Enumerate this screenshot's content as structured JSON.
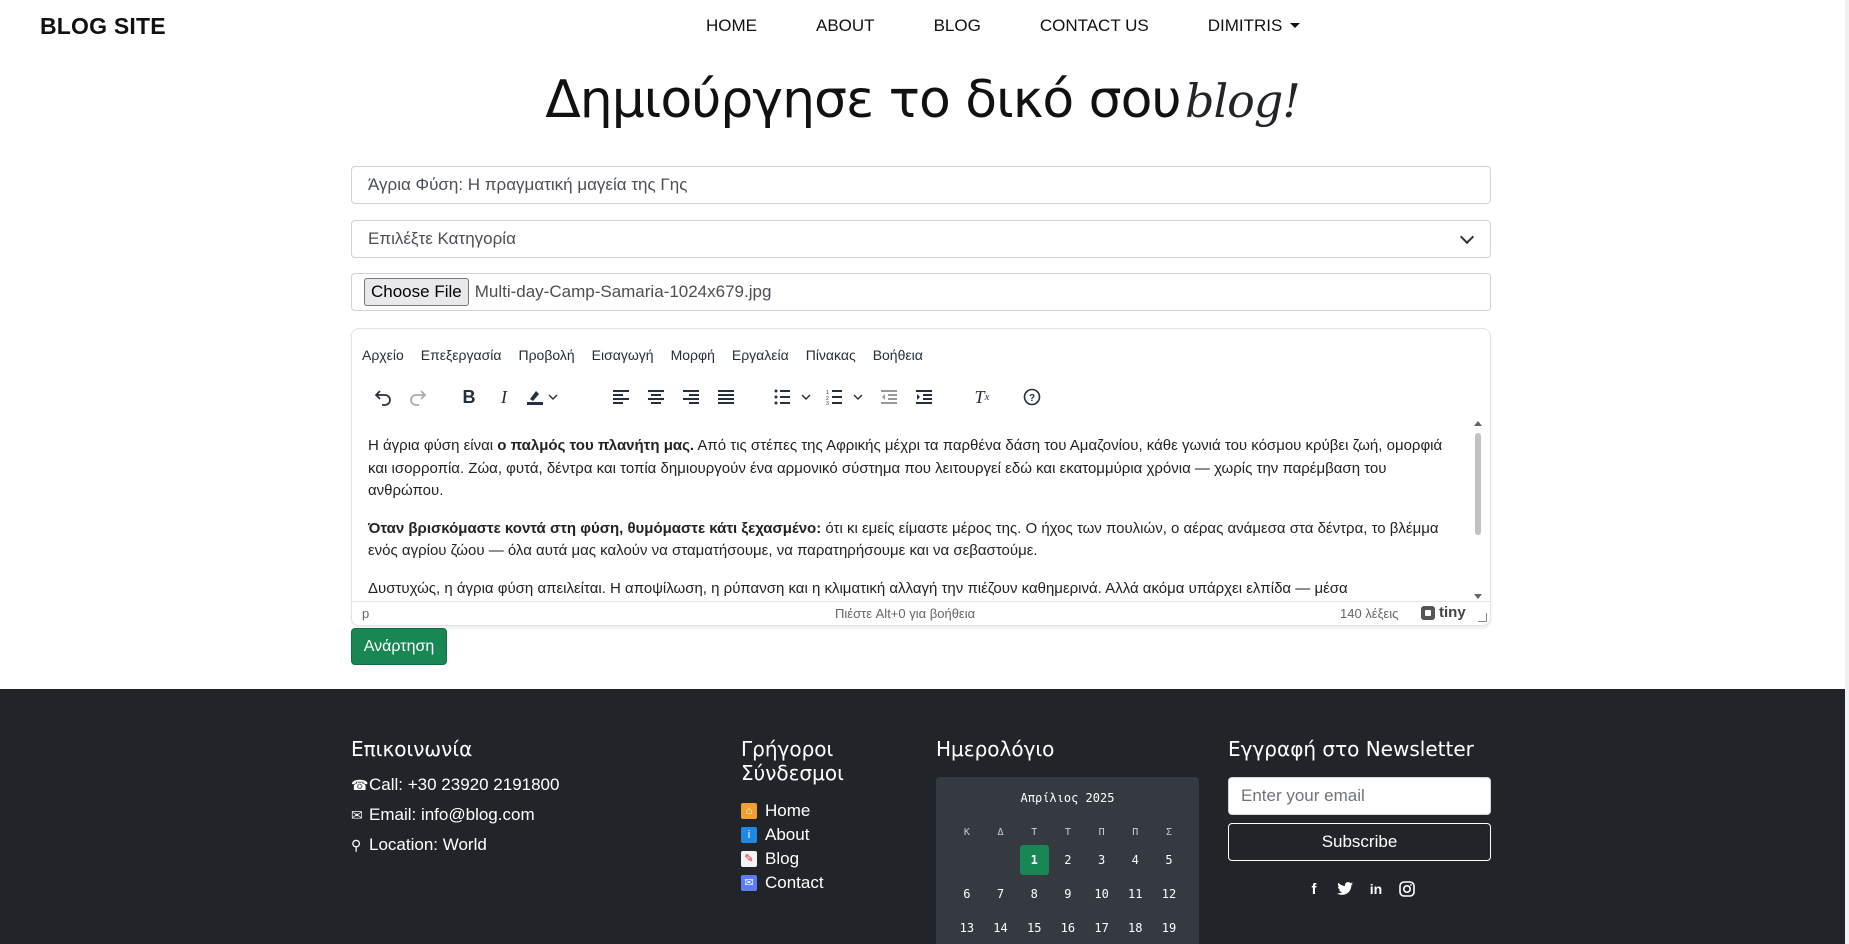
{
  "brand": "BLOG SITE",
  "nav": {
    "links": [
      "HOME",
      "ABOUT",
      "BLOG",
      "CONTACT US"
    ],
    "user": "DIMITRIS"
  },
  "hero": {
    "title": "Δημιούργησε το δικό σου",
    "accent": "blog!"
  },
  "form": {
    "title_value": "Άγρια Φύση: Η πραγματική μαγεία της Γης",
    "category_selected": "Επιλέξτε Κατηγορία",
    "file_button": "Choose File",
    "file_name": "Multi-day-Camp-Samaria-1024x679.jpg",
    "submit_label": "Ανάρτηση"
  },
  "editor": {
    "menu": [
      "Αρχείο",
      "Επεξεργασία",
      "Προβολή",
      "Εισαγωγή",
      "Μορφή",
      "Εργαλεία",
      "Πίνακας",
      "Βοήθεια"
    ],
    "p1_bold": "ο παλμός του πλανήτη μας.",
    "p1_pre": "Η άγρια φύση είναι ",
    "p1_post": " Από τις στέπες της Αφρικής μέχρι τα παρθένα δάση του Αμαζονίου, κάθε γωνιά του κόσμου κρύβει ζωή, ομορφιά και ισορροπία. Ζώα, φυτά, δέντρα και τοπία δημιουργούν ένα αρμονικό σύστημα που λειτουργεί εδώ και εκατομμύρια χρόνια — χωρίς την παρέμβαση του ανθρώπου.",
    "p2_bold": "Όταν βρισκόμαστε κοντά στη φύση, θυμόμαστε κάτι ξεχασμένο:",
    "p2_post": " ότι κι εμείς είμαστε μέρος της. Ο ήχος των πουλιών, ο αέρας ανάμεσα στα δέντρα, το βλέμμα ενός αγρίου ζώου — όλα αυτά μας καλούν να σταματήσουμε, να παρατηρήσουμε και να σεβαστούμε.",
    "p3": "Δυστυχώς, η άγρια φύση απειλείται. Η αποψίλωση, η ρύπανση και η κλιματική αλλαγή την πιέζουν καθημερινά. Αλλά ακόμα υπάρχει ελπίδα — μέσα",
    "status_path": "p",
    "status_help": "Πιέστε Alt+0 για βοήθεια",
    "status_count": "140 λέξεις",
    "status_brand": "tiny"
  },
  "footer": {
    "contact": {
      "heading": "Επικοινωνία",
      "phone": "Call: +30 23920 2191800",
      "email": "Email: info@blog.com",
      "location": "Location: World"
    },
    "quick": {
      "heading": "Γρήγοροι Σύνδεσμοι",
      "links": [
        "Home",
        "About",
        "Blog",
        "Contact"
      ]
    },
    "calendar": {
      "heading": "Ημερολόγιο",
      "month": "Απρίλιος 2025",
      "days": [
        "Κ",
        "Δ",
        "Τ",
        "Τ",
        "Π",
        "Π",
        "Σ"
      ],
      "rows": [
        [
          "",
          "",
          "1",
          "2",
          "3",
          "4",
          "5"
        ],
        [
          "6",
          "7",
          "8",
          "9",
          "10",
          "11",
          "12"
        ],
        [
          "13",
          "14",
          "15",
          "16",
          "17",
          "18",
          "19"
        ]
      ],
      "today": "1"
    },
    "newsletter": {
      "heading": "Εγγραφή στο Newsletter",
      "placeholder": "Enter your email",
      "button": "Subscribe"
    }
  },
  "colors": {
    "success": "#198754",
    "footer_bg": "#212529",
    "calendar_bg": "#343a40"
  }
}
